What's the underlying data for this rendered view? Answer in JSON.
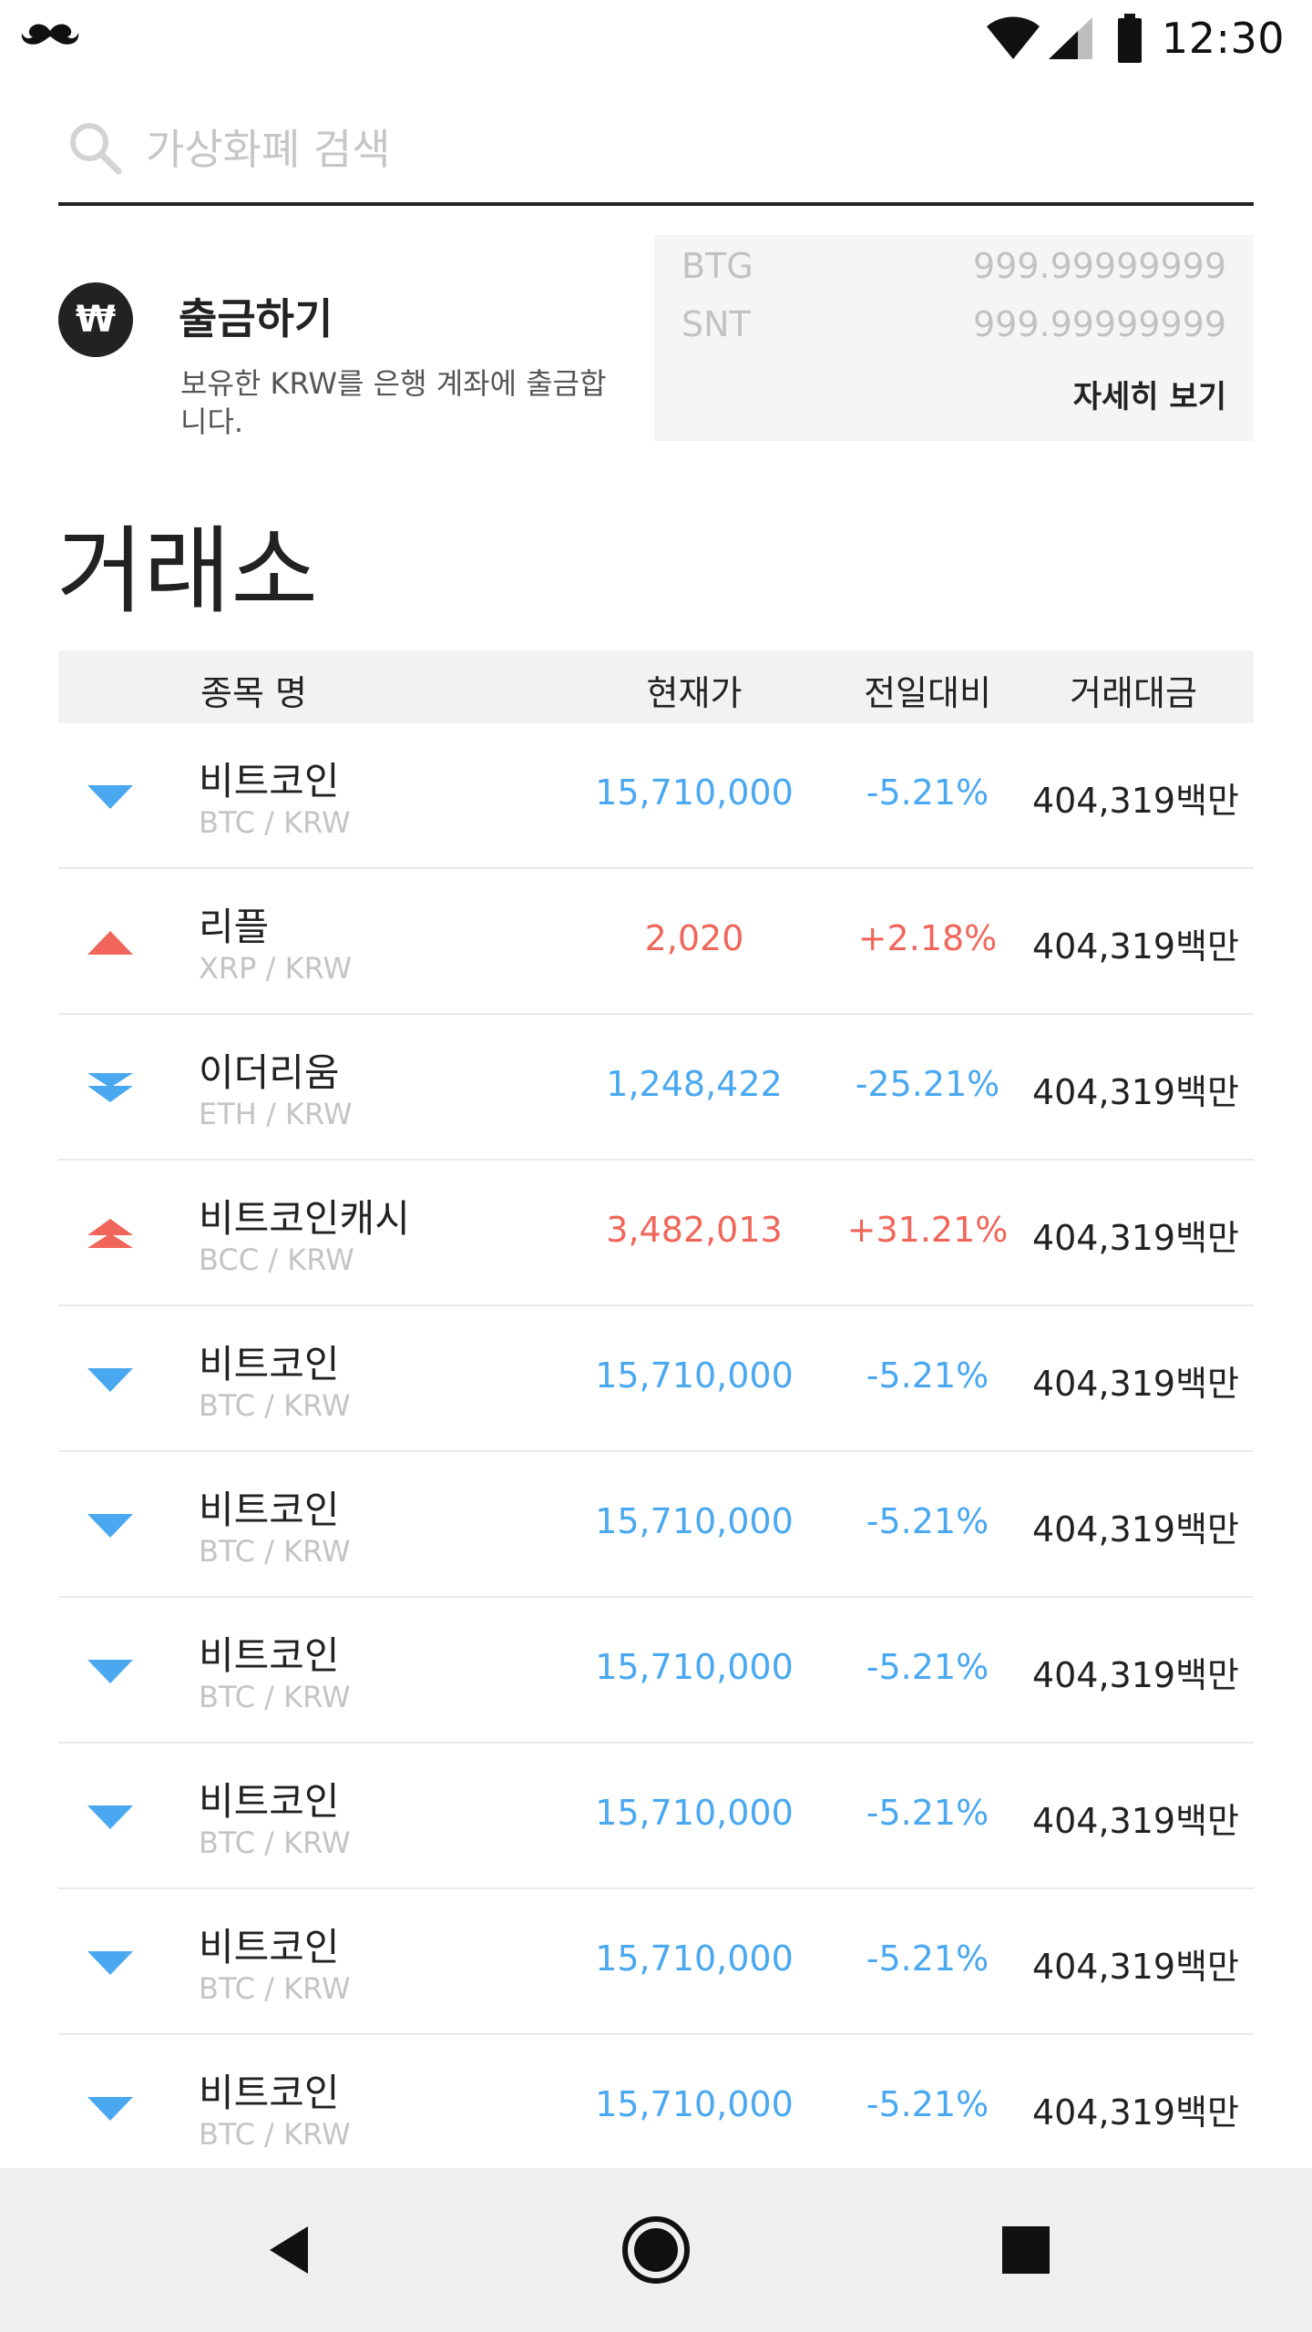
{
  "status_bar": {
    "time": "12:30",
    "icons": [
      "mustache-icon",
      "wifi-icon",
      "signal-icon",
      "battery-icon"
    ]
  },
  "search": {
    "placeholder": "가상화폐 검색",
    "value": ""
  },
  "withdraw": {
    "icon_symbol": "₩",
    "title": "출금하기",
    "description": "보유한 KRW를 은행 계좌에 출금합니다."
  },
  "balances": {
    "items": [
      {
        "symbol": "BTG",
        "amount": "999.99999999"
      },
      {
        "symbol": "SNT",
        "amount": "999.99999999"
      }
    ],
    "details_label": "자세히 보기"
  },
  "exchange": {
    "title": "거래소",
    "columns": {
      "name": "종목 명",
      "price": "현재가",
      "change": "전일대비",
      "volume": "거래대금"
    },
    "rows": [
      {
        "name": "비트코인",
        "pair": "BTC / KRW",
        "price": "15,710,000",
        "change": "-5.21%",
        "volume": "404,319백만",
        "trend": "down"
      },
      {
        "name": "리플",
        "pair": "XRP / KRW",
        "price": "2,020",
        "change": "+2.18%",
        "volume": "404,319백만",
        "trend": "up"
      },
      {
        "name": "이더리움",
        "pair": "ETH / KRW",
        "price": "1,248,422",
        "change": "-25.21%",
        "volume": "404,319백만",
        "trend": "down-double"
      },
      {
        "name": "비트코인캐시",
        "pair": "BCC / KRW",
        "price": "3,482,013",
        "change": "+31.21%",
        "volume": "404,319백만",
        "trend": "up-double"
      },
      {
        "name": "비트코인",
        "pair": "BTC / KRW",
        "price": "15,710,000",
        "change": "-5.21%",
        "volume": "404,319백만",
        "trend": "down"
      },
      {
        "name": "비트코인",
        "pair": "BTC / KRW",
        "price": "15,710,000",
        "change": "-5.21%",
        "volume": "404,319백만",
        "trend": "down"
      },
      {
        "name": "비트코인",
        "pair": "BTC / KRW",
        "price": "15,710,000",
        "change": "-5.21%",
        "volume": "404,319백만",
        "trend": "down"
      },
      {
        "name": "비트코인",
        "pair": "BTC / KRW",
        "price": "15,710,000",
        "change": "-5.21%",
        "volume": "404,319백만",
        "trend": "down"
      },
      {
        "name": "비트코인",
        "pair": "BTC / KRW",
        "price": "15,710,000",
        "change": "-5.21%",
        "volume": "404,319백만",
        "trend": "down"
      },
      {
        "name": "비트코인",
        "pair": "BTC / KRW",
        "price": "15,710,000",
        "change": "-5.21%",
        "volume": "404,319백만",
        "trend": "down"
      }
    ]
  },
  "colors": {
    "down": "#4aa8f0",
    "up": "#f0665a"
  },
  "nav": {
    "icons": [
      "back-icon",
      "home-icon",
      "recents-icon"
    ]
  }
}
